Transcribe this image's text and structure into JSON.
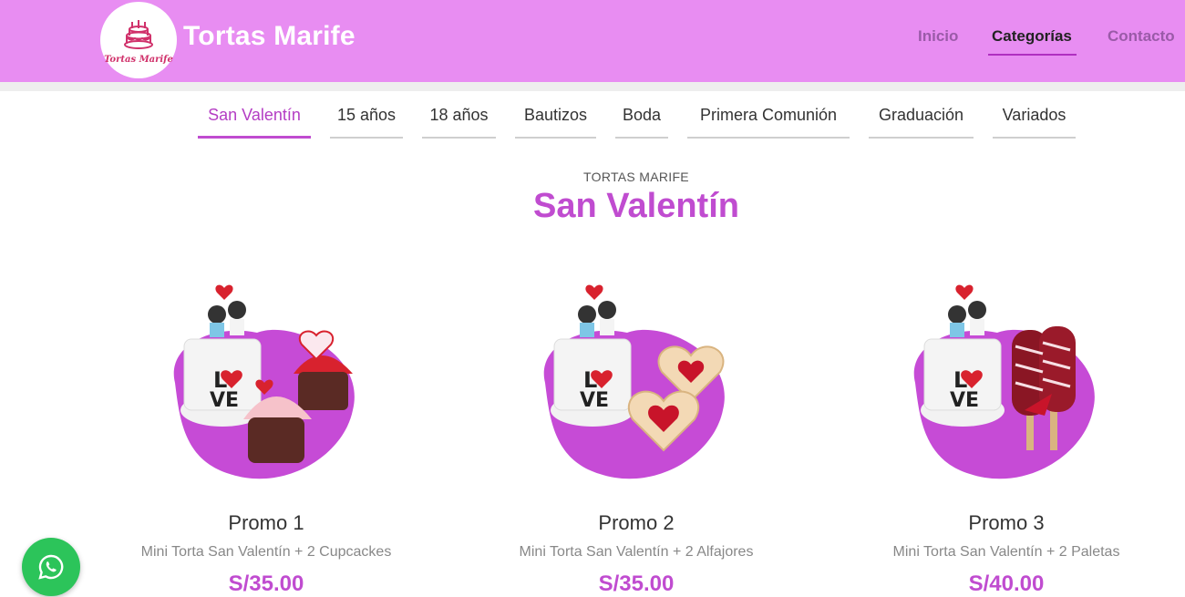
{
  "header": {
    "brand": "Tortas Marife",
    "logo_text": "Tortas Marife",
    "nav": [
      {
        "label": "Inicio"
      },
      {
        "label": "Categorías",
        "active": true
      },
      {
        "label": "Contacto"
      }
    ]
  },
  "tabs": [
    {
      "label": "San Valentín",
      "active": true
    },
    {
      "label": "15 años"
    },
    {
      "label": "18 años"
    },
    {
      "label": "Bautizos"
    },
    {
      "label": "Boda"
    },
    {
      "label": "Primera Comunión"
    },
    {
      "label": "Graduación"
    },
    {
      "label": "Variados"
    }
  ],
  "section": {
    "eyebrow": "TORTAS MARIFE",
    "title": "San Valentín"
  },
  "products": [
    {
      "name": "Promo 1",
      "description": "Mini Torta San Valentín + 2 Cupcackes",
      "price": "S/35.00",
      "image_icon": "cake-cupcakes-image"
    },
    {
      "name": "Promo 2",
      "description": "Mini Torta San Valentín + 2 Alfajores",
      "price": "S/35.00",
      "image_icon": "cake-alfajores-image"
    },
    {
      "name": "Promo 3",
      "description": "Mini Torta San Valentín + 2 Paletas",
      "price": "S/40.00",
      "image_icon": "cake-paletas-image"
    }
  ],
  "colors": {
    "header_bg": "#e88df2",
    "accent": "#c04cd0",
    "whatsapp": "#2cc45a"
  },
  "floating": {
    "icon": "whatsapp-icon"
  }
}
